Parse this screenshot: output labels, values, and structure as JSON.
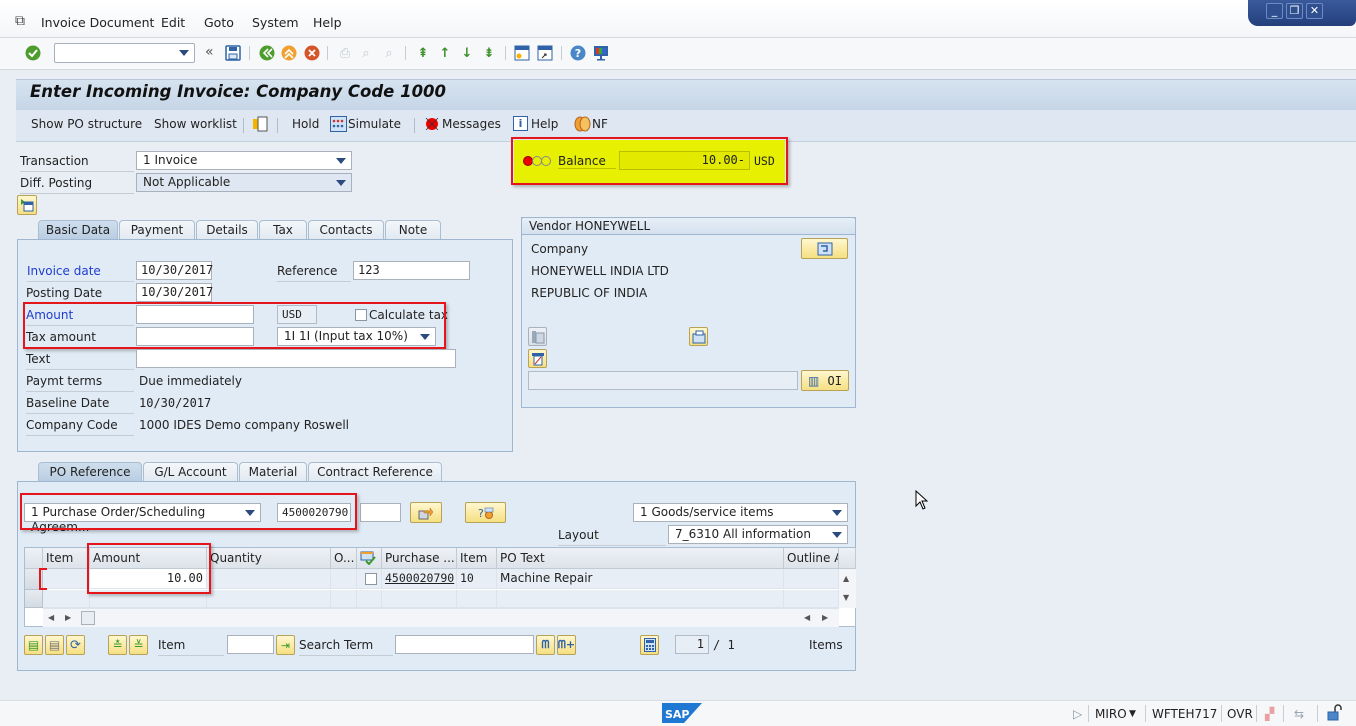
{
  "menu": {
    "items": [
      "Invoice Document",
      "Edit",
      "Goto",
      "System",
      "Help"
    ],
    "mnemonics": [
      "I",
      "E",
      "G",
      "y",
      "H"
    ]
  },
  "window_controls": {
    "minimize": "_",
    "restore": "❐",
    "close": "✕"
  },
  "toolbar": {
    "command_field_value": "",
    "icons": [
      "enter-icon",
      "save-icon",
      "back-icon",
      "exit-icon",
      "cancel-icon",
      "print-icon",
      "find-icon",
      "find-next-icon",
      "first-page-icon",
      "previous-page-icon",
      "next-page-icon",
      "last-page-icon",
      "new-session-icon",
      "shortcut-icon",
      "help-icon",
      "customize-layout-icon"
    ],
    "expand_glyph": "«"
  },
  "header": {
    "title": "Enter Incoming Invoice: Company Code 1000"
  },
  "app_toolbar": {
    "show_po_structure": "Show PO structure",
    "show_worklist": "Show worklist",
    "hold": "Hold",
    "simulate": "Simulate",
    "messages": "Messages",
    "help": "Help",
    "nf": "NF"
  },
  "top_form": {
    "transaction_label": "Transaction",
    "transaction_value": "1 Invoice",
    "diff_posting_label": "Diff. Posting",
    "diff_posting_value": "Not Applicable"
  },
  "balance": {
    "label": "Balance",
    "value": "10.00-",
    "currency": "USD",
    "status": "red"
  },
  "header_tabs": [
    "Basic Data",
    "Payment",
    "Details",
    "Tax",
    "Contacts",
    "Note"
  ],
  "basic_data": {
    "invoice_date_label": "Invoice date",
    "invoice_date": "10/30/2017",
    "reference_label": "Reference",
    "reference": "123",
    "posting_date_label": "Posting Date",
    "posting_date": "10/30/2017",
    "amount_label": "Amount",
    "amount": "",
    "currency": "USD",
    "calculate_tax_label": "Calculate tax",
    "calculate_tax_checked": false,
    "tax_amount_label": "Tax amount",
    "tax_amount": "",
    "tax_code": "1I 1I (Input tax 10%)",
    "text_label": "Text",
    "text": "",
    "paymt_terms_label": "Paymt terms",
    "paymt_terms": "Due immediately",
    "baseline_date_label": "Baseline Date",
    "baseline_date": "10/30/2017",
    "company_code_label": "Company Code",
    "company_code": "1000 IDES Demo company Roswell"
  },
  "vendor": {
    "title": "Vendor HONEYWELL",
    "company_label": "Company",
    "name": "HONEYWELL INDIA LTD",
    "country": "REPUBLIC OF INDIA",
    "oi_label": "OI",
    "oi_field": ""
  },
  "po_tabs": [
    "PO Reference",
    "G/L Account",
    "Material",
    "Contract Reference"
  ],
  "po_reference": {
    "doc_type": "1 Purchase Order/Scheduling Agreem...",
    "po_number": "4500020790",
    "extra_field": "",
    "item_type": "1 Goods/service items",
    "layout_label": "Layout",
    "layout_value": "7_6310 All information"
  },
  "items_table": {
    "columns": [
      "Item",
      "Amount",
      "Quantity",
      "O...",
      "",
      "Purchase ...",
      "Item",
      "PO Text",
      "Outline A"
    ],
    "rows": [
      {
        "item": "",
        "amount": "10.00",
        "quantity": "",
        "o": "",
        "checked": false,
        "purchase_order": "4500020790",
        "po_item": "10",
        "po_text": "Machine Repair",
        "outline": ""
      }
    ]
  },
  "table_footer": {
    "item_label": "Item",
    "item_value": "",
    "search_term_label": "Search Term",
    "search_term_value": "",
    "page_current": "1",
    "page_total": "/ 1",
    "items_label": "Items"
  },
  "status_bar": {
    "transaction": "MIRO",
    "server": "WFTEH717",
    "mode": "OVR",
    "logo": "SAP"
  }
}
